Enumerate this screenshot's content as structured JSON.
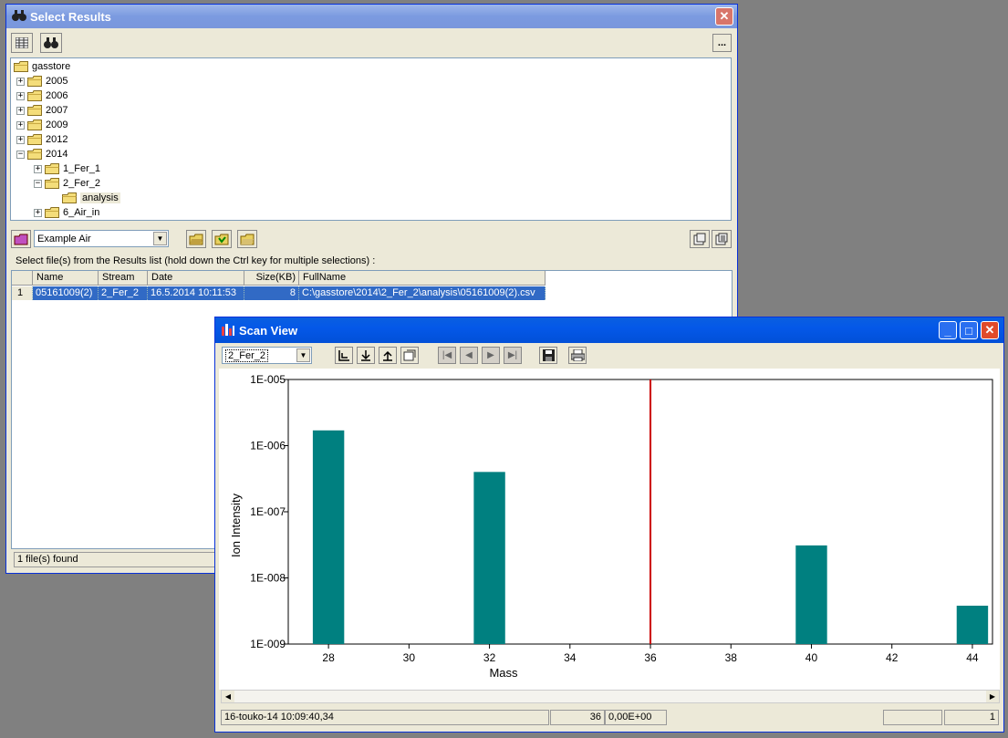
{
  "select_results": {
    "title": "Select Results",
    "tree": {
      "root": "gasstore",
      "years": [
        "2005",
        "2006",
        "2007",
        "2009",
        "2012",
        "2014"
      ],
      "children_2014": [
        "1_Fer_1",
        "2_Fer_2",
        "6_Air_in"
      ],
      "children_2_fer_2": [
        "analysis"
      ]
    },
    "method_combo": "Example Air",
    "instruction": "Select file(s) from the Results list  (hold down the Ctrl key for multiple selections) :",
    "columns": [
      "Name",
      "Stream",
      "Date",
      "Size(KB)",
      "FullName"
    ],
    "rows": [
      {
        "index": "1",
        "name": "05161009(2)",
        "stream": "2_Fer_2",
        "date": "16.5.2014 10:11:53",
        "size": "8",
        "fullname": "C:\\gasstore\\2014\\2_Fer_2\\analysis\\05161009(2).csv"
      }
    ],
    "status": "1 file(s) found",
    "more_label": "..."
  },
  "scan_view": {
    "title": "Scan View",
    "stream_combo": "2_Fer_2",
    "status_time": "16-touko-14 10:09:40,34",
    "status_mass": "36",
    "status_value": "0,00E+00",
    "status_page": "1"
  },
  "chart_data": {
    "type": "bar",
    "xlabel": "Mass",
    "ylabel": "Ion Intensity",
    "y_scale": "log",
    "ylim": [
      1e-09,
      1e-05
    ],
    "y_ticks": [
      "1E-005",
      "1E-006",
      "1E-007",
      "1E-008",
      "1E-009"
    ],
    "xlim": [
      27,
      44.5
    ],
    "x_ticks": [
      "28",
      "30",
      "32",
      "34",
      "36",
      "38",
      "40",
      "42",
      "44"
    ],
    "categories": [
      28,
      32,
      40,
      44
    ],
    "values": [
      1.7e-06,
      4e-07,
      3.1e-08,
      3.8e-09
    ],
    "bar_color": "#008080",
    "cursor_x": 36,
    "cursor_color": "#cc0000",
    "grid": false
  }
}
